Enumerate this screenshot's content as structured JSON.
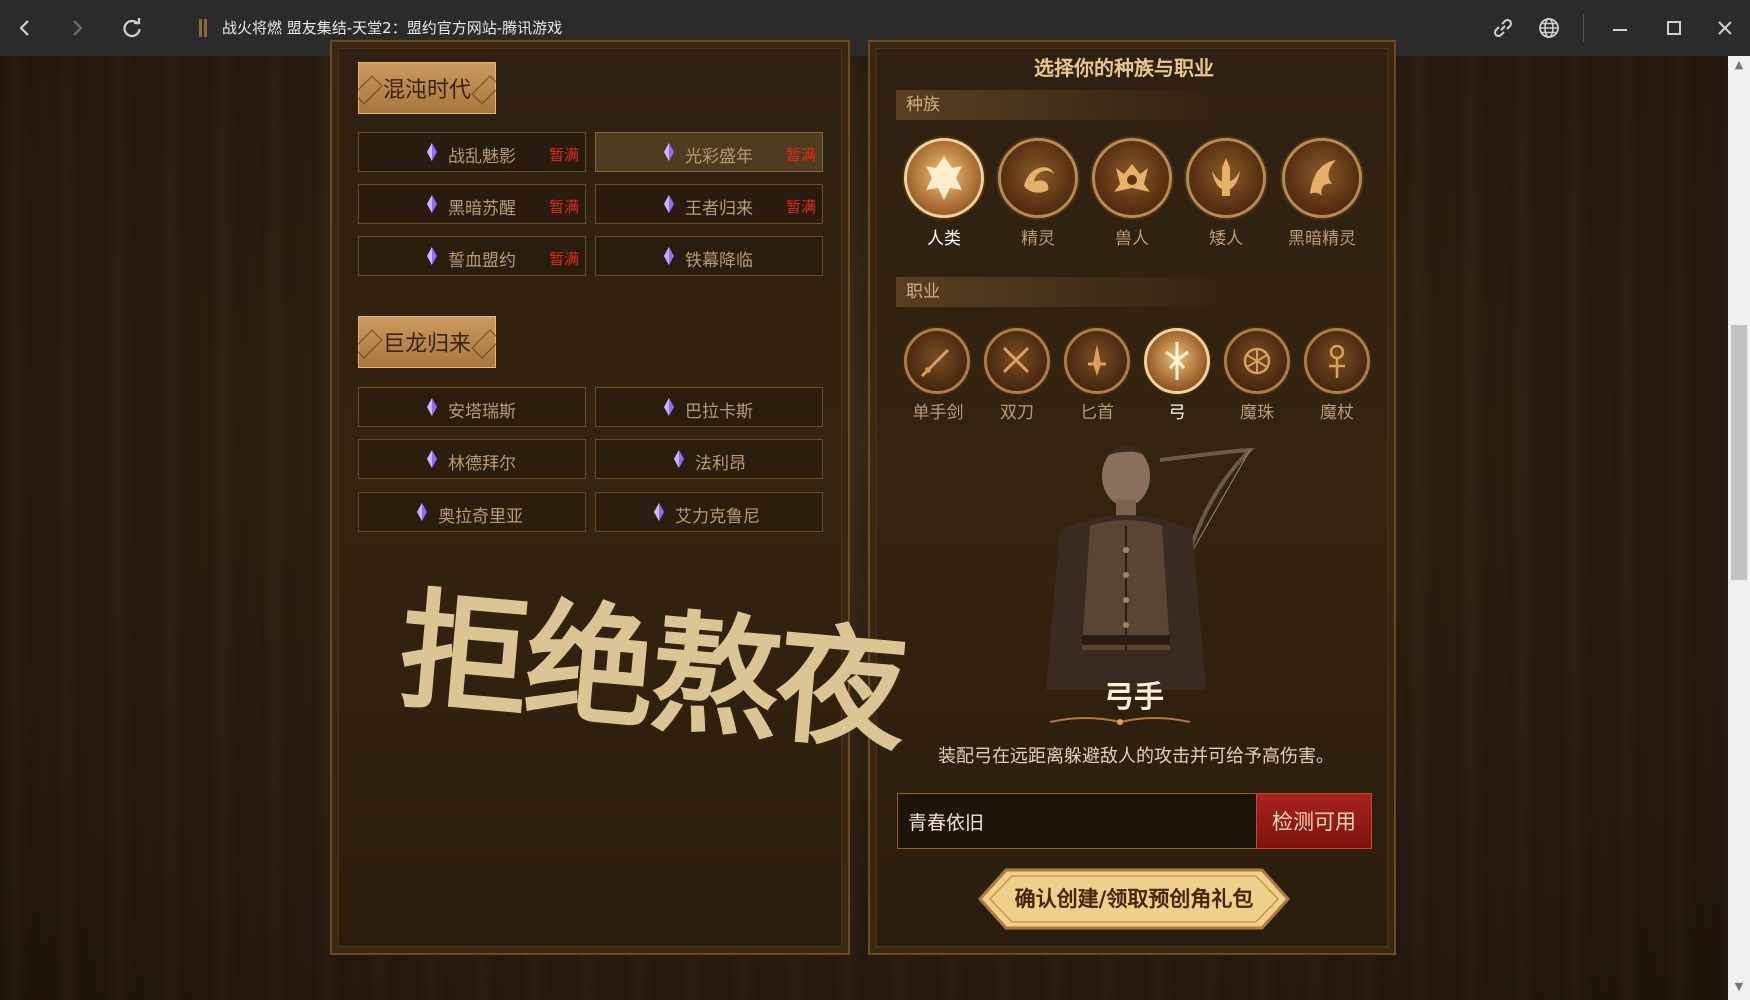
{
  "browser": {
    "title": "战火将燃 盟友集结-天堂2：盟约官方网站-腾讯游戏"
  },
  "left": {
    "eras": [
      {
        "name": "混沌时代",
        "servers": [
          {
            "name": "战乱魅影",
            "status": "暂满"
          },
          {
            "name": "光彩盛年",
            "status": "暂满"
          },
          {
            "name": "黑暗苏醒",
            "status": "暂满"
          },
          {
            "name": "王者归来",
            "status": "暂满"
          },
          {
            "name": "誓血盟约",
            "status": "暂满"
          },
          {
            "name": "铁幕降临",
            "status": ""
          }
        ]
      },
      {
        "name": "巨龙归来",
        "servers": [
          {
            "name": "安塔瑞斯",
            "status": ""
          },
          {
            "name": "巴拉卡斯",
            "status": ""
          },
          {
            "name": "林德拜尔",
            "status": ""
          },
          {
            "name": "法利昂",
            "status": ""
          },
          {
            "name": "奥拉奇里亚",
            "status": ""
          },
          {
            "name": "艾力克鲁尼",
            "status": ""
          }
        ]
      }
    ],
    "selected_server": "光彩盛年",
    "watermark": "拒绝熬夜"
  },
  "right": {
    "title": "选择你的种族与职业",
    "race_label": "种族",
    "races": [
      {
        "name": "人类",
        "icon": "human-emblem-icon"
      },
      {
        "name": "精灵",
        "icon": "elf-emblem-icon"
      },
      {
        "name": "兽人",
        "icon": "orc-emblem-icon"
      },
      {
        "name": "矮人",
        "icon": "dwarf-emblem-icon"
      },
      {
        "name": "黑暗精灵",
        "icon": "dark-elf-emblem-icon"
      }
    ],
    "selected_race": "人类",
    "class_label": "职业",
    "classes": [
      {
        "name": "单手剑",
        "icon": "sword-icon"
      },
      {
        "name": "双刀",
        "icon": "dual-blades-icon"
      },
      {
        "name": "匕首",
        "icon": "dagger-icon"
      },
      {
        "name": "弓",
        "icon": "bow-icon"
      },
      {
        "name": "魔珠",
        "icon": "orb-icon"
      },
      {
        "name": "魔杖",
        "icon": "staff-icon"
      }
    ],
    "selected_class": "弓",
    "character_name": "弓手",
    "character_desc": "装配弓在远距离躲避敌人的攻击并可给予高伤害。",
    "name_input_value": "青春依旧",
    "check_button": "检测可用",
    "confirm_button": "确认创建/领取预创角礼包"
  },
  "colors": {
    "full_status": "#e02a1d",
    "gold": "#e8c68c",
    "check_red": "#a8231c"
  }
}
